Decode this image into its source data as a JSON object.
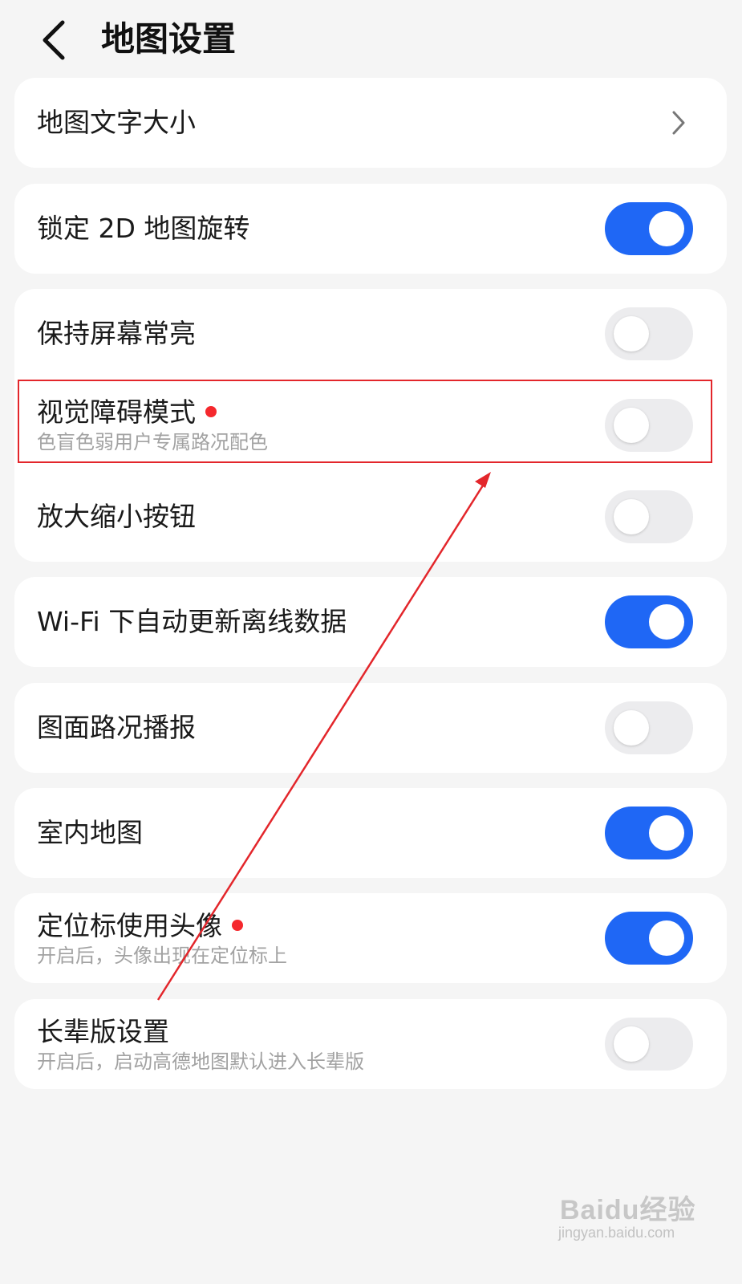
{
  "header": {
    "title": "地图设置",
    "back_icon": "chevron-left-icon"
  },
  "settings": {
    "map_text_size": {
      "label": "地图文字大小",
      "icon": "chevron-right-icon"
    },
    "lock_2d_rotation": {
      "label": "锁定 2D 地图旋转",
      "on": true
    },
    "keep_screen_on": {
      "label": "保持屏幕常亮",
      "on": false
    },
    "visual_impairment_mode": {
      "label": "视觉障碍模式",
      "sublabel": "色盲色弱用户专属路况配色",
      "has_new_dot": true,
      "on": false
    },
    "zoom_buttons": {
      "label": "放大缩小按钮",
      "on": false
    },
    "wifi_auto_update": {
      "label": "Wi-Fi 下自动更新离线数据",
      "on": true
    },
    "traffic_broadcast": {
      "label": "图面路况播报",
      "on": false
    },
    "indoor_map": {
      "label": "室内地图",
      "on": true
    },
    "avatar_location_marker": {
      "label": "定位标使用头像",
      "sublabel": "开启后，头像出现在定位标上",
      "has_new_dot": true,
      "on": true
    },
    "elder_mode": {
      "label": "长辈版设置",
      "sublabel": "开启后，启动高德地图默认进入长辈版",
      "on": false
    }
  },
  "annotation": {
    "highlight_color": "#e3262b",
    "arrow_color": "#e3262b"
  },
  "watermark": {
    "brand": "Baidu经验",
    "url": "jingyan.baidu.com"
  },
  "colors": {
    "toggle_on": "#1f67f5",
    "toggle_off": "#ececee",
    "new_dot": "#f5282d",
    "background": "#f5f5f5"
  }
}
